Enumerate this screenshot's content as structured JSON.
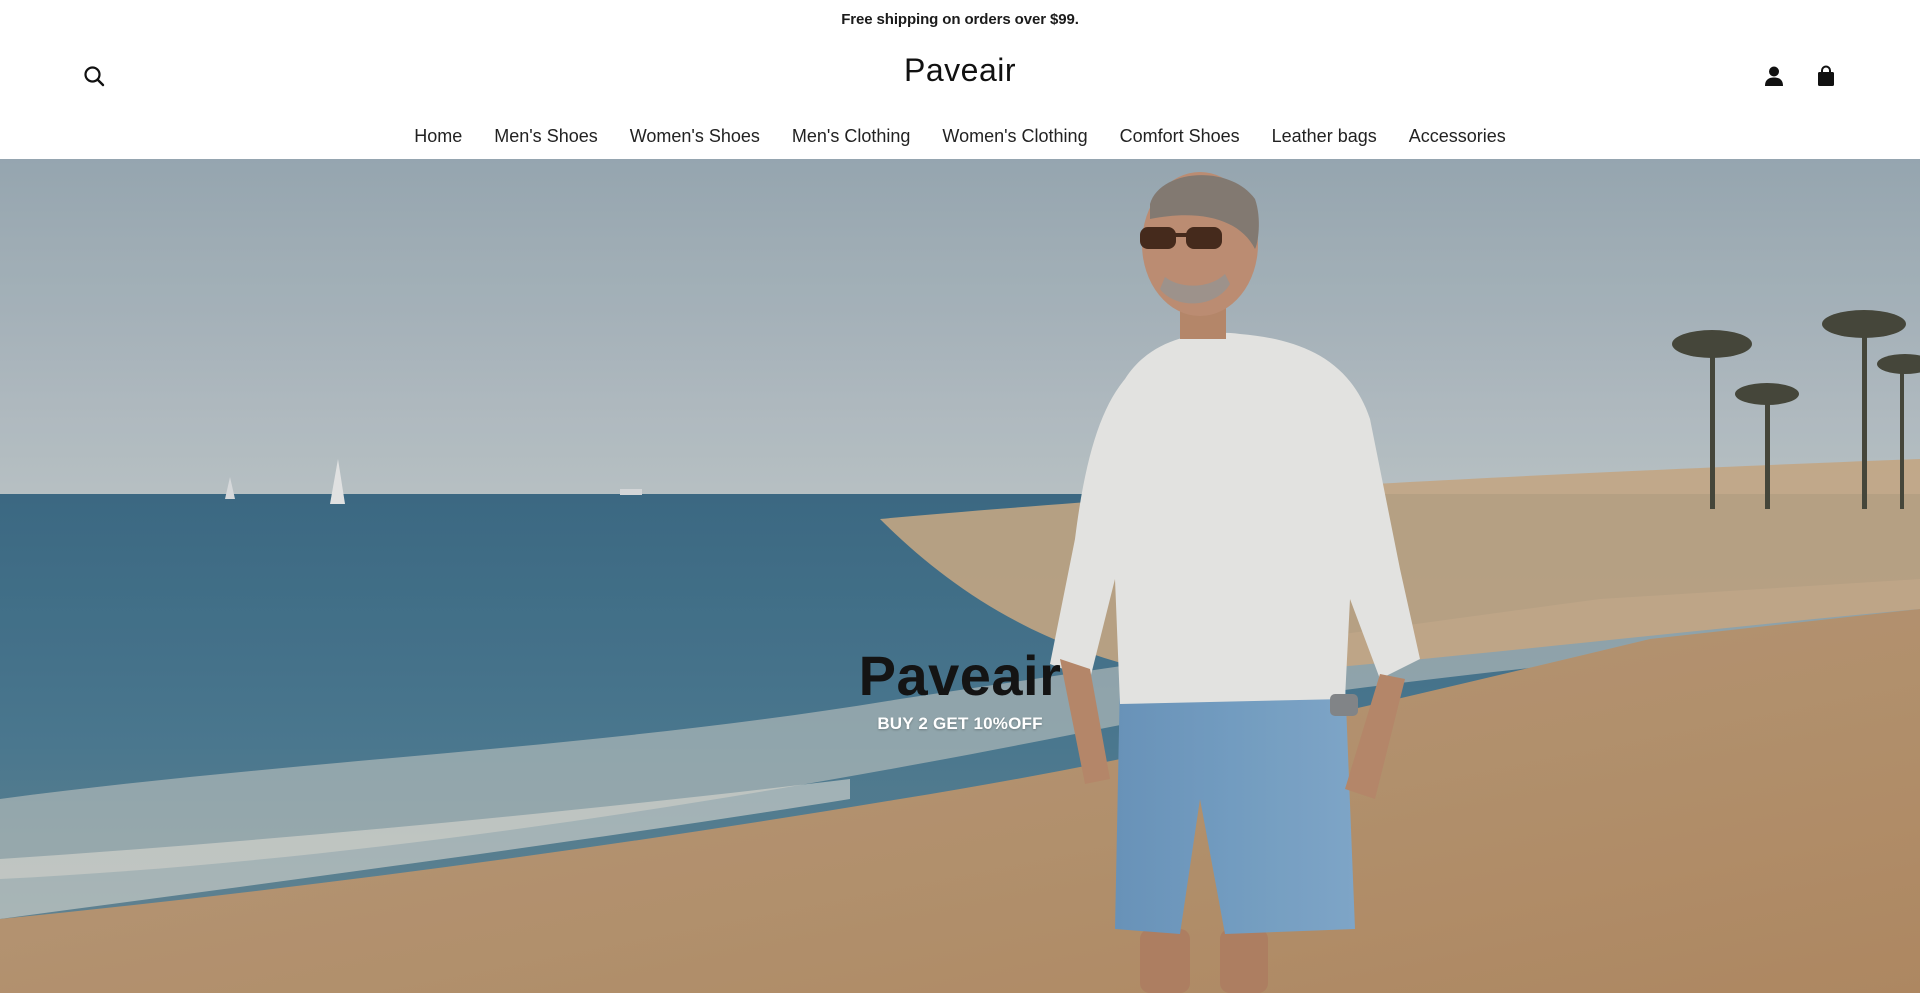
{
  "announcement": {
    "text": "Free shipping on orders over $99."
  },
  "header": {
    "logo": "Paveair",
    "icons": {
      "search": "search-icon",
      "account": "account-icon",
      "cart": "shopping-bag-icon"
    }
  },
  "nav": {
    "items": [
      {
        "label": "Home"
      },
      {
        "label": "Men's Shoes"
      },
      {
        "label": "Women's Shoes"
      },
      {
        "label": "Men's Clothing"
      },
      {
        "label": "Women's Clothing"
      },
      {
        "label": "Comfort Shoes"
      },
      {
        "label": "Leather bags"
      },
      {
        "label": "Accessories"
      }
    ]
  },
  "hero": {
    "title": "Paveair",
    "subtitle": "BUY 2 GET 10%OFF"
  },
  "colors": {
    "text": "#1a1a1a",
    "background": "#ffffff",
    "sky": "#a8b9c4",
    "sea": "#4d7c95",
    "sand": "#c9a67e"
  }
}
